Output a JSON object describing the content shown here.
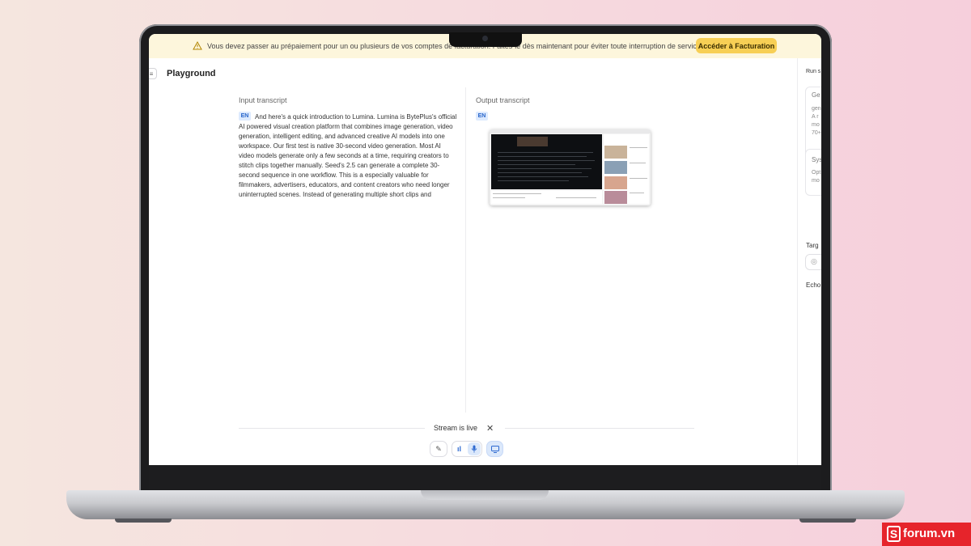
{
  "banner": {
    "message": "Vous devez passer au prépaiement pour un ou plusieurs de vos comptes de facturation. Faites-le dès maintenant pour éviter toute interruption de service.",
    "button_label": "Accéder à Facturation"
  },
  "header": {
    "title": "Playground"
  },
  "input": {
    "label": "Input transcript",
    "lang": "EN",
    "text": "And here's a quick introduction to Lumina. Lumina is BytePlus's official AI powered visual creation platform that combines image generation, video generation, intelligent editing, and advanced creative AI models into one workspace. Our first test is native 30-second video generation. Most AI video models generate only a few seconds at a time, requiring creators to stitch clips together manually. Seed's 2.5 can generate a complete 30-second sequence in one workflow. This is a especially valuable for filmmakers, advertisers, educators, and content creators who need longer uninterrupted scenes. Instead of generating multiple short clips and"
  },
  "output": {
    "label": "Output transcript",
    "lang": "EN"
  },
  "settings": {
    "title": "Run s",
    "card1_title": "Ge",
    "card1_lines": [
      "gen",
      "A r",
      "mo",
      "70+"
    ],
    "card2_title": "Sys",
    "card2_lines": [
      "Opt",
      "mo"
    ],
    "target_label": "Targ",
    "echo_label": "Echo"
  },
  "stream": {
    "status": "Stream is live",
    "close": "✕"
  },
  "icons": {
    "warning": "warning-icon",
    "sidebar": "sidebar-toggle-icon",
    "caption": "caption-off-icon",
    "waveform": "waveform-icon",
    "mic": "microphone-icon",
    "screen": "screen-share-icon",
    "globe": "globe-icon"
  },
  "glyphs": {
    "caption": "✎",
    "waveform": "ıl",
    "mic": "🎙",
    "screen": "▭",
    "globe": "◎",
    "sidebar": "≡"
  },
  "watermark": {
    "s": "S",
    "text": "forum.vn"
  },
  "colors": {
    "accent": "#f7cf55",
    "badge": "#ddeafe",
    "brand": "#e6242b"
  }
}
